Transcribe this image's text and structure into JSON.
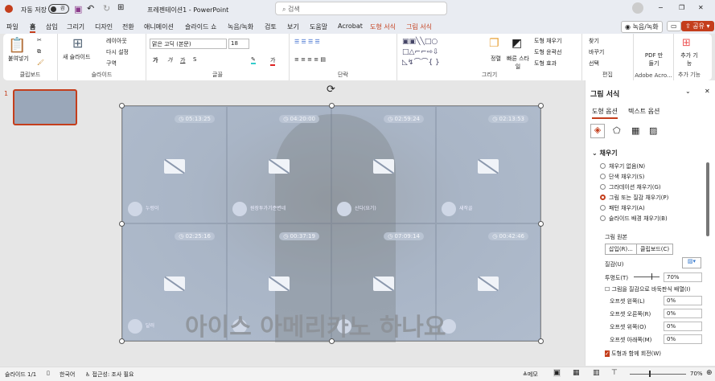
{
  "titlebar": {
    "autosave": "자동 저장",
    "toggle": "끔",
    "filename": "프레젠테이션1 - PowerPoint",
    "search_placeholder": "검색",
    "minimize": "−",
    "restore": "❐",
    "close": "✕"
  },
  "tabs": [
    "파일",
    "홈",
    "삽입",
    "그리기",
    "디자인",
    "전환",
    "애니메이션",
    "슬라이드 쇼",
    "녹음/녹화",
    "검토",
    "보기",
    "도움말",
    "Acrobat",
    "도형 서식",
    "그림 서식"
  ],
  "tab_actions": {
    "record": "◉ 녹음/녹화",
    "share": "공유"
  },
  "ribbon": {
    "clipboard": {
      "label": "클립보드",
      "paste": "붙여넣기"
    },
    "slides": {
      "label": "슬라이드",
      "new": "새 슬라이드",
      "layout": "레이아웃",
      "reset": "다시 설정",
      "section": "구역"
    },
    "font": {
      "label": "글꼴",
      "name": "맑은 고딕 (본문)",
      "size": "18",
      "bold": "가",
      "italic": "가",
      "underline": "가",
      "strike": "S"
    },
    "paragraph": {
      "label": "단락"
    },
    "drawing": {
      "label": "그리기",
      "arrange": "정렬",
      "quick_styles": "빠른 스타일",
      "fill": "도형 채우기",
      "outline": "도형 윤곽선",
      "effects": "도형 효과"
    },
    "editing": {
      "label": "편집",
      "find": "찾기",
      "replace": "바꾸기",
      "select": "선택"
    },
    "acrobat": {
      "label": "Adobe Acro...",
      "pdf": "PDF 만들기"
    },
    "addins": {
      "label": "추가 기능",
      "btn": "추가 기능"
    }
  },
  "thumb_number": "1",
  "slide": {
    "subtitle": "아이스 아메리카노 하나요",
    "tiles": [
      {
        "timer": "05:13:25",
        "name": "누렁이"
      },
      {
        "timer": "04:20:00",
        "name": "원장투가기준변네"
      },
      {
        "timer": "02:59:24",
        "name": "산다(요기)"
      },
      {
        "timer": "02:13:53",
        "name": "새작골"
      },
      {
        "timer": "02:25:16",
        "name": "달러"
      },
      {
        "timer": "00:37:19",
        "name": ""
      },
      {
        "timer": "07:09:14",
        "name": ""
      },
      {
        "timer": "00:42:46",
        "name": ""
      }
    ]
  },
  "pane": {
    "title": "그림 서식",
    "tabs": [
      "도형 옵션",
      "텍스트 옵션"
    ],
    "section": "채우기",
    "options": [
      "채우기 없음(N)",
      "단색 채우기(S)",
      "그라데이션 채우기(G)",
      "그림 또는 질감 채우기(P)",
      "패턴 채우기(A)",
      "슬라이드 배경 채우기(B)"
    ],
    "selected_index": 3,
    "source_label": "그림 원본",
    "insert": "삽입(R)...",
    "clipboard": "클립보드(C)",
    "texture": "질감(U)",
    "transparency_label": "투명도(T)",
    "transparency": "70%",
    "transparency_value": 70,
    "tile_check": "그림을 질감으로 바둑판식 배열(I)",
    "offsets": [
      {
        "label": "오프셋 왼쪽(L)",
        "value": "0%"
      },
      {
        "label": "오프셋 오른쪽(R)",
        "value": "0%"
      },
      {
        "label": "오프셋 위쪽(O)",
        "value": "0%"
      },
      {
        "label": "오프셋 아래쪽(M)",
        "value": "0%"
      }
    ],
    "rotate_check": "도형과 함께 회전(W)"
  },
  "status": {
    "slide": "슬라이드 1/1",
    "lang": "한국어",
    "access": "접근성: 조사 필요",
    "notes": "메모",
    "zoom": "70%"
  },
  "colors": {
    "accent": "#c43e1c"
  }
}
